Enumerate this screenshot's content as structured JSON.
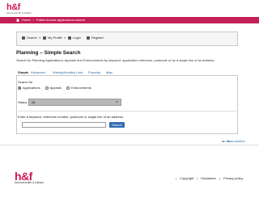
{
  "brand": {
    "mark": "h&f",
    "subtitle": "hammersmith & fulham"
  },
  "breadcrumb": {
    "home": "Home",
    "current": "Public Access applications search"
  },
  "user_nav": {
    "search": "Search",
    "profile": "My Profile",
    "login": "Login",
    "register": "Register"
  },
  "page": {
    "title": "Planning – Simple Search",
    "lead": "Search for Planning Applications, Appeals and Enforcements by keyword, application reference, postcode or by a single line of an address."
  },
  "tabs": [
    {
      "label": "Simple",
      "active": true
    },
    {
      "label": "Advanced",
      "active": false
    },
    {
      "label": "Weekly/Monthly Lists",
      "active": false
    },
    {
      "label": "Property",
      "active": false
    },
    {
      "label": "Map",
      "active": false
    }
  ],
  "form": {
    "search_for_label": "Search for",
    "options": [
      "Applications",
      "Appeals",
      "Enforcements"
    ],
    "selected_option": "Applications",
    "status_label": "Status",
    "status_value": "All",
    "keyword_label": "Enter a keyword, reference number, postcode or single line of an address.",
    "keyword_value": "",
    "search_button": "Search"
  },
  "idox": {
    "prefix": "an",
    "brand": "idox",
    "suffix": "solution"
  },
  "footer": {
    "links": [
      "Copyright",
      "Disclaimer",
      "Privacy policy"
    ]
  },
  "colors": {
    "brand": "#c41f55",
    "link": "#2a6aa8",
    "button": "#356cb0"
  }
}
